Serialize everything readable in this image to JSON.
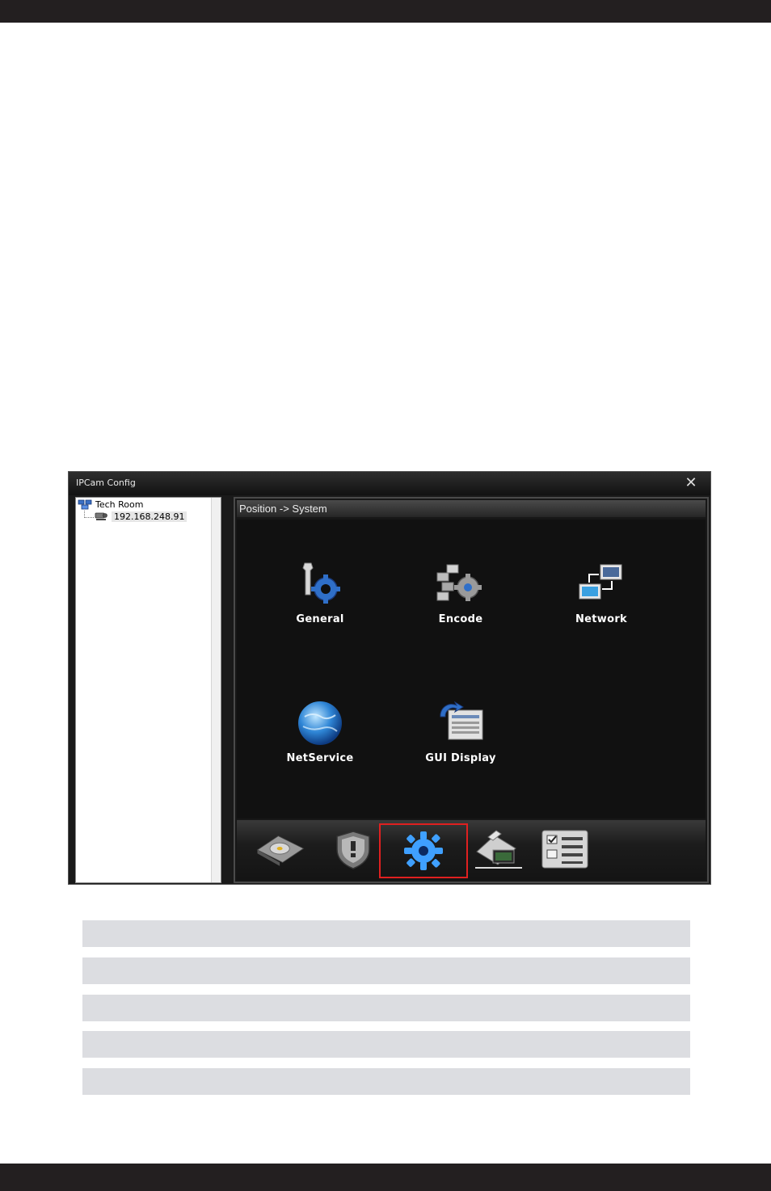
{
  "window": {
    "title": "IPCam Config",
    "close_glyph": "✕"
  },
  "tree": {
    "root_label": "Tech Room",
    "device_ip": "192.168.248.91",
    "root_icon": "network-group-icon",
    "device_icon": "camera-device-icon"
  },
  "main": {
    "breadcrumb": "Position -> System",
    "tiles": [
      {
        "label": "General",
        "icon": "wrench-gear-icon"
      },
      {
        "label": "Encode",
        "icon": "encode-gears-icon"
      },
      {
        "label": "Network",
        "icon": "network-computers-icon"
      },
      {
        "label": "NetService",
        "icon": "globe-icon"
      },
      {
        "label": "GUI Display",
        "icon": "gui-display-icon"
      }
    ]
  },
  "toolbar": {
    "items": [
      {
        "icon": "record-storage-icon"
      },
      {
        "icon": "alarm-shield-icon"
      },
      {
        "icon": "system-gear-icon",
        "selected": true
      },
      {
        "icon": "advanced-tools-icon"
      },
      {
        "icon": "info-checklist-icon"
      }
    ],
    "selected_color": "#e02020"
  }
}
